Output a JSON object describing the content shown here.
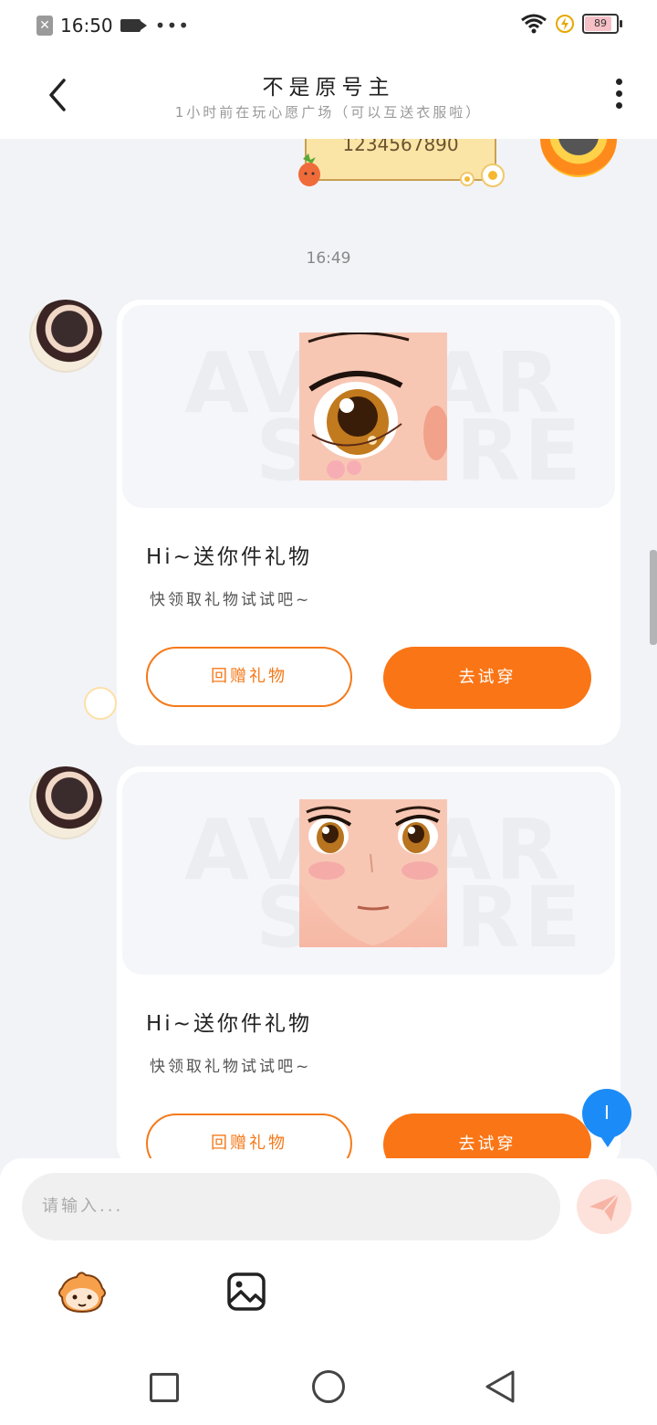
{
  "status_bar": {
    "time": "16:50",
    "dots": "•••",
    "battery": "89"
  },
  "header": {
    "title": "不是原号主",
    "subtitle": "1小时前在玩心愿广场（可以互送衣服啦）"
  },
  "prev_message": {
    "text": "1234567890"
  },
  "time_divider": "16:49",
  "gift_cards": [
    {
      "title": "Hi~送你件礼物",
      "desc": "快领取礼物试试吧~",
      "return_gift_label": "回赠礼物",
      "try_on_label": "去试穿",
      "watermark_1": "AVATAR",
      "watermark_2": "STORE"
    },
    {
      "title": "Hi~送你件礼物",
      "desc": "快领取礼物试试吧~",
      "return_gift_label": "回赠礼物",
      "try_on_label": "去试穿",
      "watermark_1": "AVATAR",
      "watermark_2": "STORE"
    }
  ],
  "floating_chat": {
    "label": "I"
  },
  "input": {
    "placeholder": "请输入..."
  },
  "colors": {
    "accent": "#fa7515",
    "background": "#f2f3f7",
    "chat_bubble": "#1b8cf7"
  }
}
